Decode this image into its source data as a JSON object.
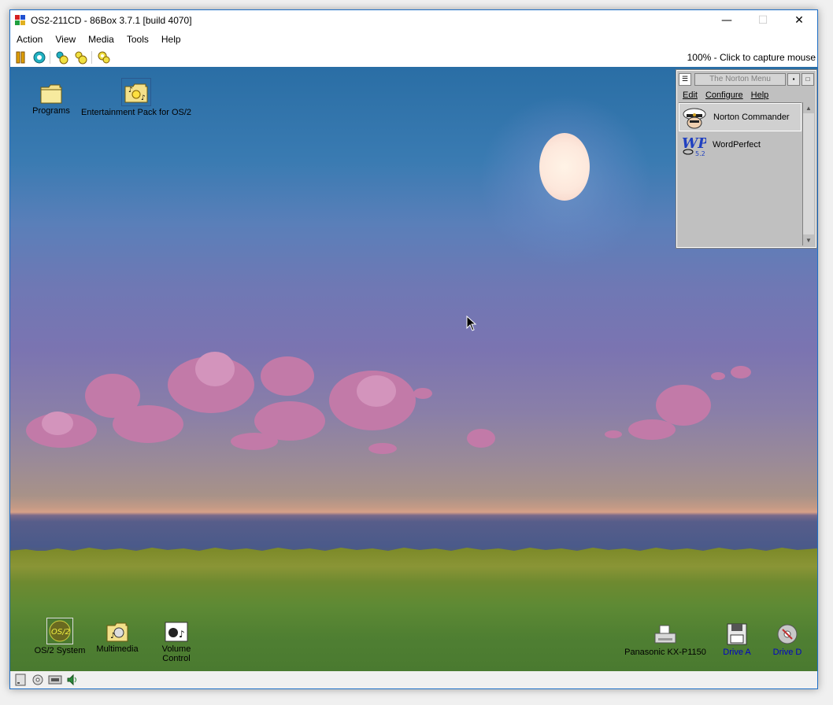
{
  "window": {
    "title": "OS2-211CD - 86Box 3.7.1 [build 4070]",
    "controls": {
      "minimize": "—",
      "maximize": "☐",
      "close": "✕"
    }
  },
  "menubar": {
    "items": [
      "Action",
      "View",
      "Media",
      "Tools",
      "Help"
    ]
  },
  "toolbar": {
    "buttons": [
      "pause-icon",
      "reset-icon",
      "ctrl-alt-del-icon",
      "ctrl-alt-esc-icon",
      "settings-icon"
    ],
    "status_text": "100% - Click to capture mouse"
  },
  "desktop": {
    "top_icons": [
      {
        "label": "Programs",
        "icon": "folder-icon"
      },
      {
        "label": "Entertainment Pack for OS/2",
        "icon": "entertainment-folder-icon"
      }
    ],
    "bottom_icons": [
      {
        "label": "OS/2 System",
        "icon": "os2-system-icon"
      },
      {
        "label": "Multimedia",
        "icon": "multimedia-icon"
      },
      {
        "label_line1": "Volume",
        "label_line2": "Control",
        "icon": "volume-control-icon"
      }
    ],
    "device_icons": [
      {
        "label": "Panasonic KX-P1150",
        "icon": "printer-icon"
      },
      {
        "label": "Drive A",
        "icon": "floppy-drive-icon"
      },
      {
        "label": "Drive D",
        "icon": "cd-drive-icon"
      }
    ]
  },
  "norton_menu": {
    "title": "The Norton Menu",
    "menu": [
      "Edit",
      "Configure",
      "Help"
    ],
    "items": [
      {
        "label": "Norton Commander",
        "icon": "norton-commander-icon"
      },
      {
        "label": "WordPerfect",
        "icon": "wordperfect-icon",
        "icon_text": "WP",
        "icon_version": "5.2"
      }
    ]
  },
  "statusbar": {
    "icons": [
      "hard-disk-icon",
      "cd-icon",
      "network-icon",
      "sound-icon"
    ]
  },
  "colors": {
    "title_accent": "#1e6fc7",
    "sky_top": "#2a6ea5",
    "sky_mid": "#7b74b1",
    "ground": "#4f7f32"
  }
}
